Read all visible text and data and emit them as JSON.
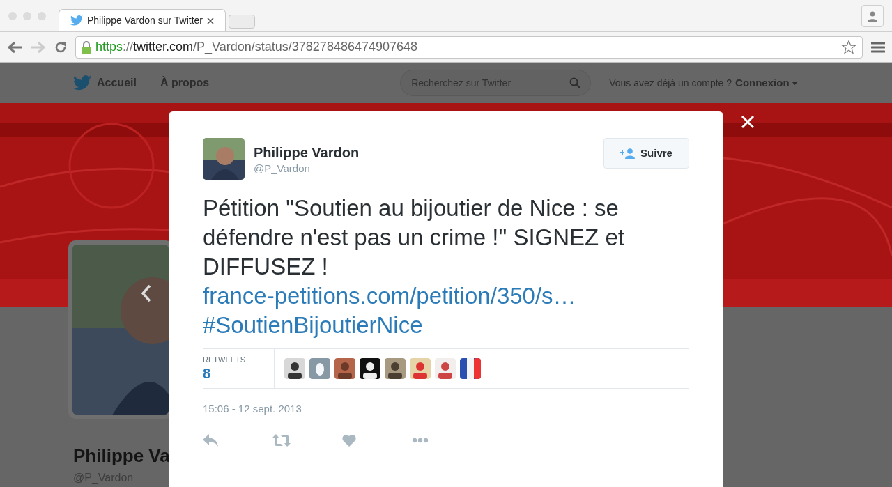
{
  "browser": {
    "tab": {
      "title": "Philippe Vardon sur Twitter",
      "selected": true
    },
    "url": [
      {
        "kind": "scheme",
        "text": "https"
      },
      {
        "kind": "sep",
        "text": "://"
      },
      {
        "kind": "host",
        "text": "twitter.com"
      },
      {
        "kind": "path",
        "text": "/P_Vardon/status/378278486474907648"
      }
    ]
  },
  "nav": {
    "items": [
      {
        "label": "Accueil",
        "kind": "home"
      },
      {
        "label": "À propos",
        "kind": "plain"
      }
    ],
    "search": {
      "placeholder": "Recherchez sur Twitter"
    },
    "account_prompt": "Vous avez déjà un compte ?",
    "login": "Connexion"
  },
  "profile": {
    "name": "Philippe Va",
    "handle": "@P_Vardon"
  },
  "modal": {
    "author": {
      "name": "Philippe Vardon",
      "handle": "@P_Vardon"
    },
    "follow_button": "Suivre",
    "tweet": [
      {
        "kind": "text",
        "text": "Pétition \"Soutien au bijoutier de Nice : se défendre n'est pas un crime !\" SIGNEZ et DIFFUSEZ ! "
      },
      {
        "kind": "link",
        "text": "france-petitions.com/petition/350/s…"
      },
      {
        "kind": "hashtag",
        "text": "#SoutienBijoutierNice"
      }
    ],
    "retweets": {
      "label": "RETWEETS",
      "count": "8"
    },
    "timestamp": "15:06 - 12 sept. 2013",
    "actions": [
      {
        "kind": "reply"
      },
      {
        "kind": "retweet"
      },
      {
        "kind": "like"
      },
      {
        "kind": "more"
      }
    ]
  }
}
